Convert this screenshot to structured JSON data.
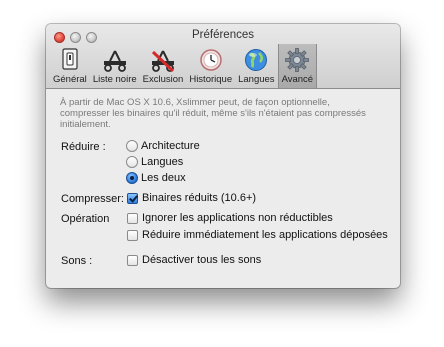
{
  "window": {
    "title": "Préférences"
  },
  "toolbar": {
    "items": [
      {
        "label": "Général",
        "icon": "switch-icon"
      },
      {
        "label": "Liste noire",
        "icon": "scissors-icon"
      },
      {
        "label": "Exclusion",
        "icon": "scissors-red-icon"
      },
      {
        "label": "Historique",
        "icon": "clock-icon"
      },
      {
        "label": "Langues",
        "icon": "globe-icon"
      },
      {
        "label": "Avancé",
        "icon": "gear-icon",
        "selected": true
      }
    ]
  },
  "description": "À partir de Mac OS X 10.6, Xslimmer peut, de façon optionnelle, compresser les binaires qu'il réduit, même s'ils n'étaient pas compressés initialement.",
  "reduce": {
    "label": "Réduire :",
    "options": [
      {
        "label": "Architecture",
        "selected": false
      },
      {
        "label": "Langues",
        "selected": false
      },
      {
        "label": "Les deux",
        "selected": true
      }
    ]
  },
  "compress": {
    "label": "Compresser:",
    "option": {
      "label": "Binaires réduits (10.6+)",
      "checked": true
    }
  },
  "operation": {
    "label": "Opération",
    "options": [
      {
        "label": "Ignorer les applications non réductibles",
        "checked": false
      },
      {
        "label": "Réduire immédiatement les applications déposées",
        "checked": false
      }
    ]
  },
  "sounds": {
    "label": "Sons :",
    "option": {
      "label": "Désactiver tous les sons",
      "checked": false
    }
  }
}
